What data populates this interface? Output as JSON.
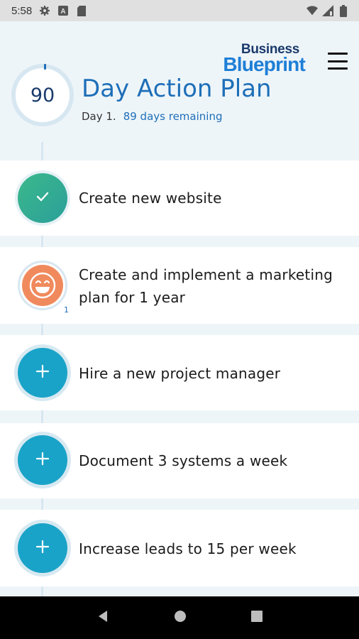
{
  "status_bar": {
    "time": "5:58",
    "icons": [
      "gear-icon",
      "a-icon",
      "sd-card-icon",
      "wifi-icon",
      "signal-icon",
      "battery-icon"
    ]
  },
  "header": {
    "logo_top": "Business",
    "logo_bottom": "Blueprint",
    "counter": "90",
    "title": "Day Action Plan",
    "day_label": "Day 1.",
    "days_remaining": "89 days remaining"
  },
  "tasks": [
    {
      "label": "Create new website",
      "status": "done",
      "icon": "check-icon"
    },
    {
      "label_lines": [
        "Create and implement a marketing",
        "plan for 1 year"
      ],
      "status": "in-progress",
      "icon": "smiley-icon",
      "count": "1"
    },
    {
      "label": "Hire a new project manager",
      "status": "todo",
      "icon": "plus-icon"
    },
    {
      "label": "Document 3 systems a week",
      "status": "todo",
      "icon": "plus-icon"
    },
    {
      "label": "Increase leads to 15 per week",
      "status": "todo",
      "icon": "plus-icon"
    }
  ],
  "colors": {
    "brand_blue": "#1e6fb8",
    "add_teal": "#1aa3c8",
    "done_green": "#3cb98b",
    "progress_orange": "#f08a5d"
  },
  "nav": [
    "back-icon",
    "home-icon",
    "recents-icon"
  ]
}
